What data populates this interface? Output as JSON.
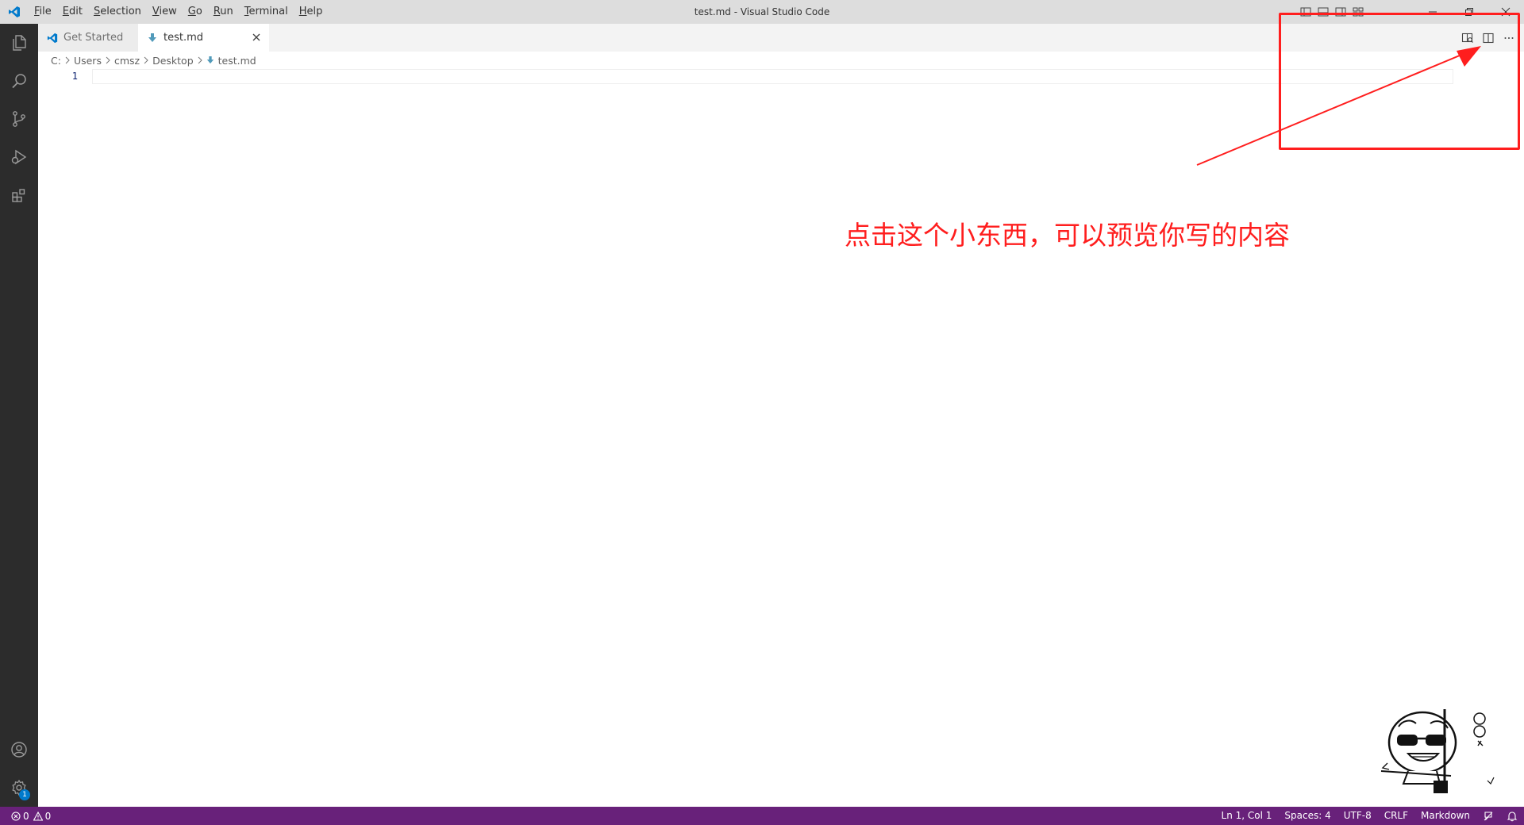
{
  "window": {
    "title": "test.md - Visual Studio Code"
  },
  "menu": [
    {
      "label": "File",
      "mnemonic": "F",
      "rest": "ile"
    },
    {
      "label": "Edit",
      "mnemonic": "E",
      "rest": "dit"
    },
    {
      "label": "Selection",
      "mnemonic": "S",
      "rest": "election"
    },
    {
      "label": "View",
      "mnemonic": "V",
      "rest": "iew"
    },
    {
      "label": "Go",
      "mnemonic": "G",
      "rest": "o"
    },
    {
      "label": "Run",
      "mnemonic": "R",
      "rest": "un"
    },
    {
      "label": "Terminal",
      "mnemonic": "T",
      "rest": "erminal"
    },
    {
      "label": "Help",
      "mnemonic": "H",
      "rest": "elp"
    }
  ],
  "tabs": [
    {
      "label": "Get Started",
      "icon": "vscode-logo-icon",
      "active": false
    },
    {
      "label": "test.md",
      "icon": "markdown-icon",
      "active": true
    }
  ],
  "breadcrumb": [
    {
      "label": "C:"
    },
    {
      "label": "Users"
    },
    {
      "label": "cmsz"
    },
    {
      "label": "Desktop"
    },
    {
      "label": "test.md",
      "icon": "markdown-icon"
    }
  ],
  "editor": {
    "line_numbers": [
      "1"
    ],
    "content": ""
  },
  "annotation": {
    "text": "点击这个小东西，可以预览你写的内容",
    "color": "#ff1e1e"
  },
  "status": {
    "errors": "0",
    "warnings": "0",
    "position": "Ln 1, Col 1",
    "spaces": "Spaces: 4",
    "encoding": "UTF-8",
    "eol": "CRLF",
    "language": "Markdown"
  },
  "settings_badge": "1",
  "colors": {
    "statusbar": "#68217a",
    "activitybar": "#2c2c2c",
    "accent": "#007acc",
    "annotation": "#ff1e1e"
  }
}
